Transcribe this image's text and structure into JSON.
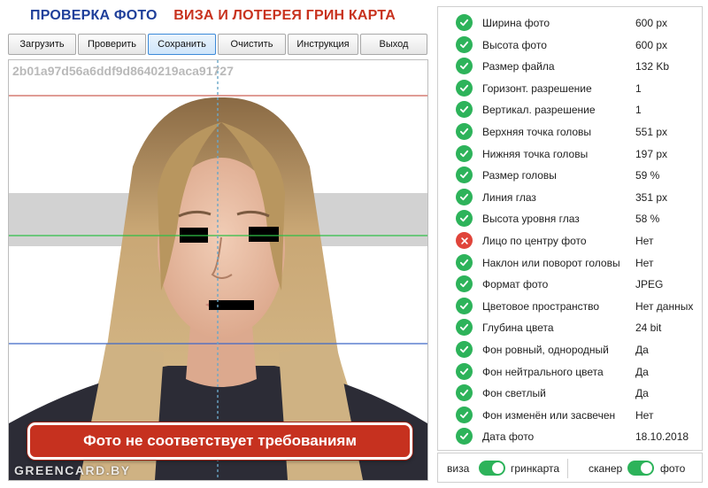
{
  "header": {
    "title_check": "ПРОВЕРКА ФОТО",
    "title_visa": "ВИЗА И ЛОТЕРЕЯ ГРИН КАРТА"
  },
  "toolbar": {
    "load_label": "Загрузить",
    "check_label": "Проверить",
    "save_label": "Сохранить",
    "clear_label": "Очистить",
    "instruction_label": "Инструкция",
    "exit_label": "Выход"
  },
  "photo": {
    "hash": "2b01a97d56a6ddf9d8640219aca91727",
    "warning": "Фото не соответствует требованиям",
    "watermark": "GREENCARD.BY"
  },
  "checks": [
    {
      "label": "Ширина фото",
      "value": "600 px",
      "status": "ok"
    },
    {
      "label": "Высота фото",
      "value": "600 px",
      "status": "ok"
    },
    {
      "label": "Размер файла",
      "value": "132 Kb",
      "status": "ok"
    },
    {
      "label": "Горизонт. разрешение",
      "value": "1",
      "status": "ok"
    },
    {
      "label": "Вертикал. разрешение",
      "value": "1",
      "status": "ok"
    },
    {
      "label": "Верхняя точка головы",
      "value": "551 px",
      "status": "ok"
    },
    {
      "label": "Нижняя точка головы",
      "value": "197 px",
      "status": "ok"
    },
    {
      "label": "Размер головы",
      "value": "59 %",
      "status": "ok"
    },
    {
      "label": "Линия глаз",
      "value": "351 px",
      "status": "ok"
    },
    {
      "label": "Высота уровня глаз",
      "value": "58 %",
      "status": "ok"
    },
    {
      "label": "Лицо по центру фото",
      "value": "Нет",
      "status": "fail"
    },
    {
      "label": "Наклон или поворот головы",
      "value": "Нет",
      "status": "ok"
    },
    {
      "label": "Формат фото",
      "value": "JPEG",
      "status": "ok"
    },
    {
      "label": "Цветовое пространство",
      "value": "Нет данных",
      "status": "ok"
    },
    {
      "label": "Глубина цвета",
      "value": "24 bit",
      "status": "ok"
    },
    {
      "label": "Фон ровный, однородный",
      "value": "Да",
      "status": "ok"
    },
    {
      "label": "Фон нейтрального цвета",
      "value": "Да",
      "status": "ok"
    },
    {
      "label": "Фон светлый",
      "value": "Да",
      "status": "ok"
    },
    {
      "label": "Фон изменён или засвечен",
      "value": "Нет",
      "status": "ok"
    },
    {
      "label": "Дата фото",
      "value": "18.10.2018",
      "status": "ok"
    }
  ],
  "switches": {
    "left_off": "виза",
    "left_on": "гринкарта",
    "right_off": "сканер",
    "right_on": "фото"
  },
  "colors": {
    "title_blue": "#1f3f9a",
    "title_red": "#c8321e",
    "ok_green": "#2db35a",
    "fail_red": "#e0443a",
    "warning_bg": "#c6311f",
    "toggle_on": "#2db35a",
    "active_button": "#cfe5fa"
  },
  "icons": {
    "ok": "check-circle-icon",
    "fail": "x-circle-icon"
  }
}
